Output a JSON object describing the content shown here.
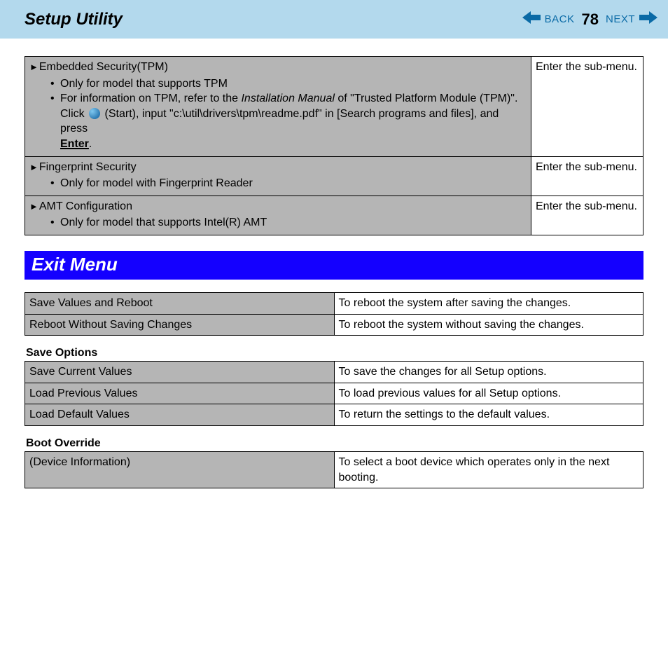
{
  "header": {
    "title": "Setup Utility",
    "back": "BACK",
    "next": "NEXT",
    "page": "78"
  },
  "topTable": {
    "r0_title": "Embedded Security(TPM)",
    "r0_b1": "Only for model that supports TPM",
    "r0_b2a": "For information on TPM, refer to the ",
    "r0_b2_em": "Installation Manual",
    "r0_b2b": " of \"Trusted Platform Module (TPM)\".",
    "r0_b2c": "Click ",
    "r0_b2d": " (Start), input \"c:\\util\\drivers\\tpm\\readme.pdf\" in [Search programs and files], and press ",
    "r0_enter": "Enter",
    "r0_b2e": ".",
    "r0_right": "Enter the sub-menu.",
    "r1_title": "Fingerprint Security",
    "r1_b1": "Only for model with Fingerprint Reader",
    "r1_right": "Enter the sub-menu.",
    "r2_title": "AMT Configuration",
    "r2_b1": "Only for model that supports Intel(R) AMT",
    "r2_right": "Enter the sub-menu."
  },
  "section": "Exit Menu",
  "exitTable": {
    "r0l": "Save Values and Reboot",
    "r0r": "To reboot the system after saving the changes.",
    "r1l": "Reboot Without Saving Changes",
    "r1r": "To reboot the system without saving the changes."
  },
  "saveHead": "Save Options",
  "saveTable": {
    "r0l": "Save Current Values",
    "r0r": "To save the changes for all Setup options.",
    "r1l": "Load Previous Values",
    "r1r": "To load previous values for all Setup options.",
    "r2l": "Load Default Values",
    "r2r": "To return the settings to the default values."
  },
  "bootHead": "Boot Override",
  "bootTable": {
    "r0l": "(Device Information)",
    "r0r": "To select a boot device which operates only in the next booting."
  }
}
